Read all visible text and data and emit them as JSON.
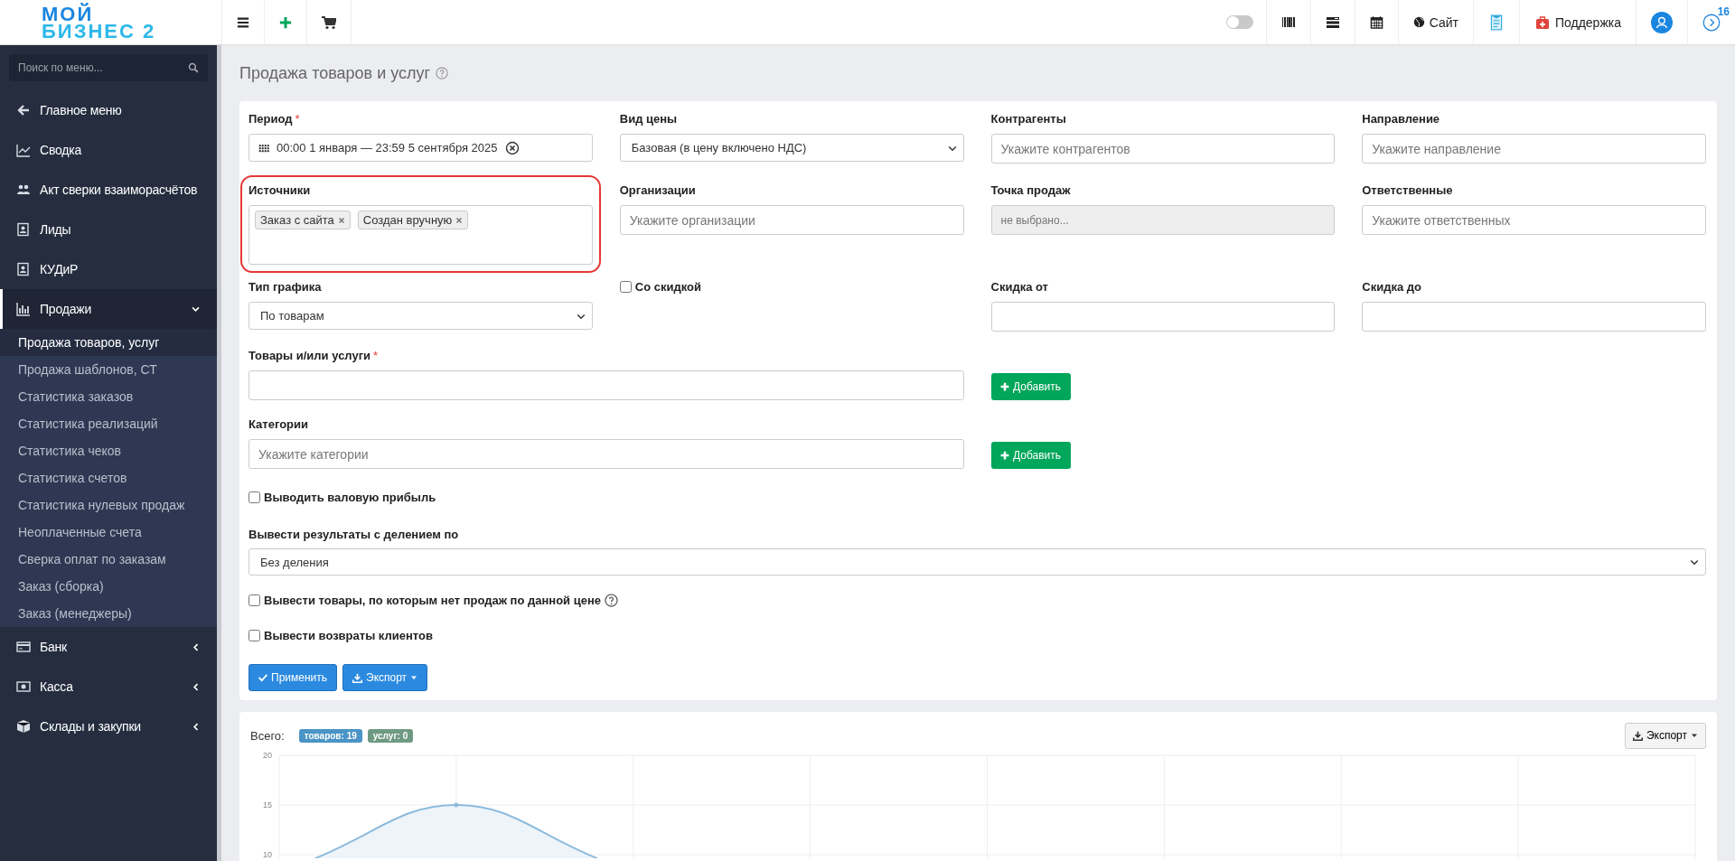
{
  "header": {
    "logo_lines": [
      "МОЙ",
      "БИЗНЕС 2"
    ],
    "toggle": {
      "on": false
    },
    "site_link": "Сайт",
    "support_link": "Поддержка",
    "notifications_count": "16"
  },
  "sidebar": {
    "search": {
      "placeholder": "Поиск по меню..."
    },
    "items": [
      {
        "kind": "link",
        "label": "Главное меню"
      },
      {
        "kind": "link",
        "label": "Сводка"
      },
      {
        "kind": "link",
        "label": "Акт сверки взаиморасчётов"
      },
      {
        "kind": "link",
        "label": "Лиды"
      },
      {
        "kind": "link",
        "label": "КУДиР"
      },
      {
        "kind": "group",
        "label": "Продажи",
        "expanded": true,
        "children": [
          {
            "label": "Продажа товаров, услуг",
            "selected": true
          },
          {
            "label": "Продажа шаблонов, СТ",
            "selected": false
          },
          {
            "label": "Статистика заказов",
            "selected": false
          },
          {
            "label": "Статистика реализаций",
            "selected": false
          },
          {
            "label": "Статистика чеков",
            "selected": false
          },
          {
            "label": "Статистика счетов",
            "selected": false
          },
          {
            "label": "Статистика нулевых продаж",
            "selected": false
          },
          {
            "label": "Неоплаченные счета",
            "selected": false
          },
          {
            "label": "Сверка оплат по заказам",
            "selected": false
          },
          {
            "label": "Заказ (сборка)",
            "selected": false
          },
          {
            "label": "Заказ (менеджеры)",
            "selected": false
          }
        ]
      },
      {
        "kind": "group",
        "label": "Банк",
        "expanded": false
      },
      {
        "kind": "group",
        "label": "Касса",
        "expanded": false
      },
      {
        "kind": "group",
        "label": "Склады и закупки",
        "expanded": false
      }
    ]
  },
  "page_title": "Продажа товаров и услуг",
  "filter_rows": [
    [
      {
        "kind": "daterange",
        "label": "Период",
        "required_mark": "*",
        "value": "00:00 1 января — 23:59 5 сентября 2025",
        "highlighted": false
      },
      {
        "kind": "select",
        "label": "Вид цены",
        "value": "Базовая (в цену включено НДС)",
        "highlighted": false
      },
      {
        "kind": "input",
        "label": "Контрагенты",
        "placeholder": "Укажите контрагентов",
        "disabled": false,
        "highlighted": false
      },
      {
        "kind": "input",
        "label": "Направление",
        "placeholder": "Укажите направление",
        "disabled": false,
        "highlighted": false
      }
    ],
    [
      {
        "kind": "tags",
        "label": "Источники",
        "tags": [
          "Заказ с сайта",
          "Создан вручную"
        ],
        "highlighted": true
      },
      {
        "kind": "input",
        "label": "Организации",
        "placeholder": "Укажите организации",
        "disabled": false,
        "highlighted": false
      },
      {
        "kind": "input",
        "label": "Точка продаж",
        "placeholder": "не выбрано...",
        "disabled": true,
        "highlighted": false
      },
      {
        "kind": "input",
        "label": "Ответственные",
        "placeholder": "Укажите ответственных",
        "disabled": false,
        "highlighted": false
      }
    ],
    [
      {
        "kind": "select",
        "label": "Тип графика",
        "value": "По товарам",
        "highlighted": false
      },
      {
        "kind": "checkbox",
        "label": "Со скидкой",
        "checked": false,
        "highlighted": false
      },
      {
        "kind": "plain-input",
        "label": "Скидка от",
        "highlighted": false
      },
      {
        "kind": "plain-input",
        "label": "Скидка до",
        "highlighted": false
      }
    ],
    [
      {
        "kind": "wide-input",
        "label": "Товары и/или услуги",
        "required_mark": "*",
        "highlighted": false
      },
      {
        "kind": "button",
        "label": "Добавить",
        "highlighted": false
      }
    ],
    [
      {
        "kind": "wide-input",
        "label": "Категории",
        "placeholder": "Укажите категории",
        "highlighted": false
      },
      {
        "kind": "button",
        "label": "Добавить",
        "highlighted": false
      }
    ]
  ],
  "gross_profit": {
    "label": "Выводить валовую прибыль",
    "checked": false
  },
  "split": {
    "label": "Вывести результаты с делением по",
    "value": "Без деления"
  },
  "options": [
    {
      "label": "Вывести товары, по которым нет продаж по данной цене",
      "checked": false,
      "help": true
    },
    {
      "label": "Вывести возвраты клиентов",
      "checked": false,
      "help": false
    }
  ],
  "actions": [
    {
      "kind": "apply",
      "label": "Применить"
    },
    {
      "kind": "export",
      "label": "Экспорт"
    }
  ],
  "results": {
    "total_label": "Всего:",
    "badges": [
      {
        "text": "товаров: 19",
        "color": "#4a94c6"
      },
      {
        "text": "услуг: 0",
        "color": "#6f9a82"
      }
    ],
    "export_label": "Экспорт",
    "y_axis_labels": [
      "20",
      "15",
      "10"
    ]
  }
}
